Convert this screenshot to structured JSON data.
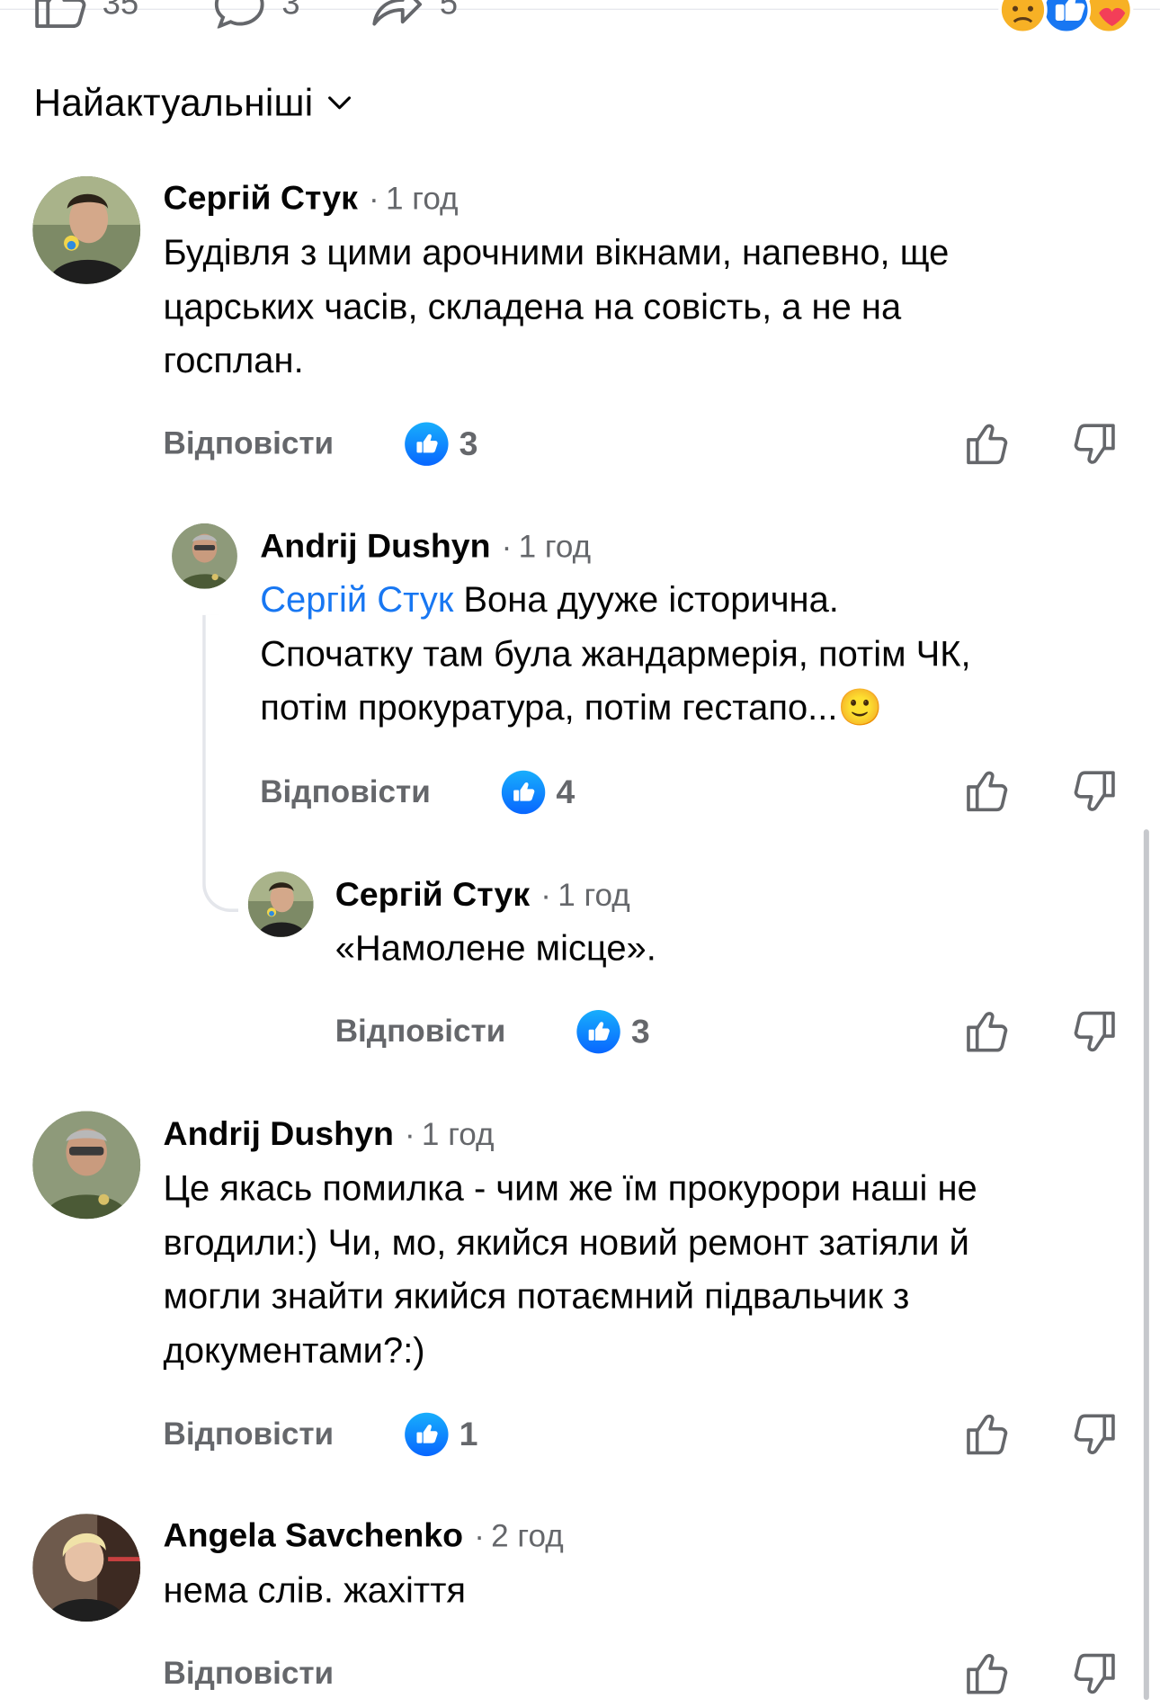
{
  "post_actions": {
    "likes_count": "35",
    "comments_count": "3",
    "shares_count": "5",
    "reaction_icons": [
      "sad-reaction-icon",
      "like-reaction-icon",
      "care-reaction-icon"
    ]
  },
  "sort": {
    "label": "Найактуальніші",
    "icon": "chevron-down-icon"
  },
  "comments": [
    {
      "author": "Сергій Стук",
      "time": "1 год",
      "mention": "",
      "text_lines": [
        "Будівля з цими арочними вікнами, напевно, ще",
        "царських часів, складена на совість, а не на",
        "госплан."
      ],
      "reply_label": "Відповісти",
      "likes": "3"
    },
    {
      "author": "Andrij Dushyn",
      "time": "1 год",
      "mention": "Сергій Стук",
      "text_first": " Вона дууже історична.",
      "text_lines": [
        "Спочатку там була жандармерія, потім ЧК,",
        "потім прокуратура, потім гестапо..."
      ],
      "emoji": "🙂",
      "reply_label": "Відповісти",
      "likes": "4"
    },
    {
      "author": "Сергій Стук",
      "time": "1 год",
      "text_lines": [
        "«Намолене місце»."
      ],
      "reply_label": "Відповісти",
      "likes": "3"
    },
    {
      "author": "Andrij Dushyn",
      "time": "1 год",
      "text_lines": [
        "Це якась помилка - чим же їм прокурори наші не",
        "вгодили:) Чи, мо, якийся новий ремонт затіяли й",
        "могли знайти якийся потаємний підвальчик з",
        "документами?:)"
      ],
      "reply_label": "Відповісти",
      "likes": "1"
    },
    {
      "author": "Angela Savchenko",
      "time": "2 год",
      "text_lines": [
        "нема слів. жахіття"
      ],
      "reply_label": "Відповісти",
      "likes": ""
    }
  ],
  "colors": {
    "text": "#050505",
    "secondary": "#65676b",
    "link": "#1877f2",
    "like_badge": "#0866ff",
    "divider": "#e4e6eb"
  }
}
